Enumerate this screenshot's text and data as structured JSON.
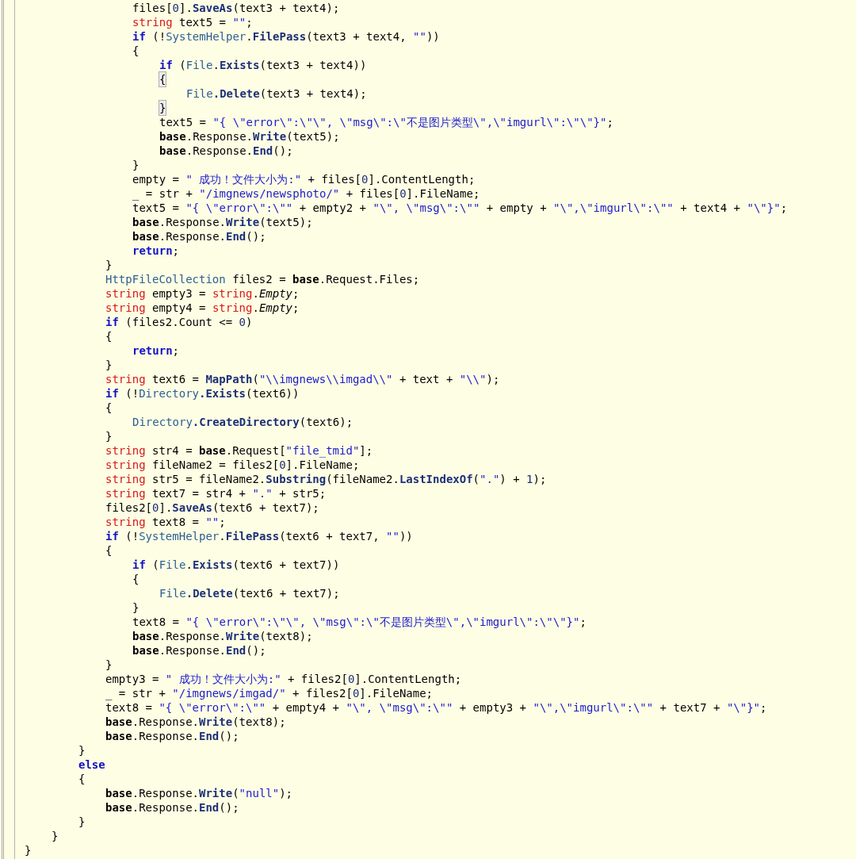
{
  "code_lines": [
    {
      "children": [
        {
          "children": [
            {
              "children": [
                {
                  "children": [
                    {
                      "tokens": [
                        "files[",
                        {
                          "kind": "number",
                          "text": "0"
                        },
                        "].",
                        {
                          "kind": "method",
                          "text": "SaveAs"
                        },
                        "(text3 + text4);"
                      ]
                    },
                    {
                      "tokens": [
                        {
                          "kind": "keyword_type",
                          "text": "string"
                        },
                        " text5 = ",
                        {
                          "kind": "string",
                          "text": "\"\""
                        },
                        ";"
                      ]
                    },
                    {
                      "tokens": [
                        {
                          "kind": "keyword",
                          "text": "if"
                        },
                        " (!",
                        {
                          "kind": "type",
                          "text": "SystemHelper"
                        },
                        ".",
                        {
                          "kind": "method",
                          "text": "FilePass"
                        },
                        "(text3 + text4, ",
                        {
                          "kind": "string",
                          "text": "\"\""
                        },
                        "))"
                      ]
                    },
                    {
                      "tokens": [
                        "{"
                      ],
                      "children": [
                        {
                          "tokens": [
                            {
                              "kind": "keyword",
                              "text": "if"
                            },
                            " (",
                            {
                              "kind": "type",
                              "text": "File"
                            },
                            ".",
                            {
                              "kind": "method",
                              "text": "Exists"
                            },
                            "(text3 + text4))"
                          ]
                        },
                        {
                          "tokens": [
                            {
                              "kind": "brace_match",
                              "text": "{"
                            }
                          ],
                          "children": [
                            {
                              "tokens": [
                                {
                                  "kind": "type",
                                  "text": "File"
                                },
                                {
                                  "kind": "method",
                                  "text": ".Delete"
                                },
                                "(text3 + text4);"
                              ]
                            }
                          ]
                        },
                        {
                          "tokens": [
                            {
                              "kind": "brace_match",
                              "text": "}"
                            }
                          ]
                        },
                        {
                          "tokens": [
                            "text5 = ",
                            {
                              "kind": "string",
                              "text": "\"{ \\\"error\\\":\\\"\\\", \\\"msg\\\":\\\"不是图片类型\\\",\\\"imgurl\\\":\\\"\\\"}\""
                            },
                            ";"
                          ]
                        },
                        {
                          "tokens": [
                            {
                              "kind": "base",
                              "text": "base"
                            },
                            ".Response.",
                            {
                              "kind": "method",
                              "text": "Write"
                            },
                            "(text5);"
                          ]
                        },
                        {
                          "tokens": [
                            {
                              "kind": "base",
                              "text": "base"
                            },
                            ".Response.",
                            {
                              "kind": "method",
                              "text": "End"
                            },
                            "();"
                          ]
                        }
                      ]
                    },
                    {
                      "tokens": [
                        "}"
                      ]
                    },
                    {
                      "tokens": [
                        "empty = ",
                        {
                          "kind": "string",
                          "text": "\" 成功！文件大小为:\""
                        },
                        " + files[",
                        {
                          "kind": "number",
                          "text": "0"
                        },
                        "].ContentLength;"
                      ]
                    },
                    {
                      "tokens": [
                        "_ = str + ",
                        {
                          "kind": "string",
                          "text": "\"/imgnews/newsphoto/\""
                        },
                        " + files[",
                        {
                          "kind": "number",
                          "text": "0"
                        },
                        "].FileName;"
                      ]
                    },
                    {
                      "tokens": [
                        "text5 = ",
                        {
                          "kind": "string",
                          "text": "\"{ \\\"error\\\":\\\"\""
                        },
                        " + empty2 + ",
                        {
                          "kind": "string",
                          "text": "\"\\\", \\\"msg\\\":\\\"\""
                        },
                        " + empty + ",
                        {
                          "kind": "string",
                          "text": "\"\\\",\\\"imgurl\\\":\\\"\""
                        },
                        " + text4 + ",
                        {
                          "kind": "string",
                          "text": "\"\\\"}\""
                        },
                        ";"
                      ]
                    },
                    {
                      "tokens": [
                        {
                          "kind": "base",
                          "text": "base"
                        },
                        ".Response.",
                        {
                          "kind": "method",
                          "text": "Write"
                        },
                        "(text5);"
                      ]
                    },
                    {
                      "tokens": [
                        {
                          "kind": "base",
                          "text": "base"
                        },
                        ".Response.",
                        {
                          "kind": "method",
                          "text": "End"
                        },
                        "();"
                      ]
                    },
                    {
                      "tokens": [
                        {
                          "kind": "keyword",
                          "text": "return"
                        },
                        ";"
                      ]
                    }
                  ]
                },
                {
                  "tokens": [
                    "}"
                  ]
                },
                {
                  "tokens": [
                    {
                      "kind": "type",
                      "text": "HttpFileCollection"
                    },
                    " files2 = ",
                    {
                      "kind": "base",
                      "text": "base"
                    },
                    ".Request.Files;"
                  ]
                },
                {
                  "tokens": [
                    {
                      "kind": "keyword_type",
                      "text": "string"
                    },
                    " empty3 = ",
                    {
                      "kind": "keyword_type",
                      "text": "string"
                    },
                    ".",
                    {
                      "kind": "static",
                      "text": "Empty"
                    },
                    ";"
                  ]
                },
                {
                  "tokens": [
                    {
                      "kind": "keyword_type",
                      "text": "string"
                    },
                    " empty4 = ",
                    {
                      "kind": "keyword_type",
                      "text": "string"
                    },
                    ".",
                    {
                      "kind": "static",
                      "text": "Empty"
                    },
                    ";"
                  ]
                },
                {
                  "tokens": [
                    {
                      "kind": "keyword",
                      "text": "if"
                    },
                    " (files2.Count <= ",
                    {
                      "kind": "number",
                      "text": "0"
                    },
                    ")"
                  ]
                },
                {
                  "tokens": [
                    "{"
                  ],
                  "children": [
                    {
                      "tokens": [
                        {
                          "kind": "keyword",
                          "text": "return"
                        },
                        ";"
                      ]
                    }
                  ]
                },
                {
                  "tokens": [
                    "}"
                  ]
                },
                {
                  "tokens": [
                    {
                      "kind": "keyword_type",
                      "text": "string"
                    },
                    " text6 = ",
                    {
                      "kind": "method",
                      "text": "MapPath"
                    },
                    "(",
                    {
                      "kind": "string",
                      "text": "\"\\\\imgnews\\\\imgad\\\\\""
                    },
                    " + text + ",
                    {
                      "kind": "string",
                      "text": "\"\\\\\""
                    },
                    ");"
                  ]
                },
                {
                  "tokens": [
                    {
                      "kind": "keyword",
                      "text": "if"
                    },
                    " (!",
                    {
                      "kind": "type",
                      "text": "Directory"
                    },
                    {
                      "kind": "method",
                      "text": ".Exists"
                    },
                    "(text6))"
                  ]
                },
                {
                  "tokens": [
                    "{"
                  ],
                  "children": [
                    {
                      "tokens": [
                        {
                          "kind": "type",
                          "text": "Directory"
                        },
                        {
                          "kind": "method",
                          "text": ".CreateDirectory"
                        },
                        "(text6);"
                      ]
                    }
                  ]
                },
                {
                  "tokens": [
                    "}"
                  ]
                },
                {
                  "tokens": [
                    {
                      "kind": "keyword_type",
                      "text": "string"
                    },
                    " str4 = ",
                    {
                      "kind": "base",
                      "text": "base"
                    },
                    ".Request[",
                    {
                      "kind": "string",
                      "text": "\"file_tmid\""
                    },
                    "];"
                  ]
                },
                {
                  "tokens": [
                    {
                      "kind": "keyword_type",
                      "text": "string"
                    },
                    " fileName2 = files2[",
                    {
                      "kind": "number",
                      "text": "0"
                    },
                    "].FileName;"
                  ]
                },
                {
                  "tokens": [
                    {
                      "kind": "keyword_type",
                      "text": "string"
                    },
                    " str5 = fileName2.",
                    {
                      "kind": "method",
                      "text": "Substring"
                    },
                    "(fileName2.",
                    {
                      "kind": "method",
                      "text": "LastIndexOf"
                    },
                    "(",
                    {
                      "kind": "string",
                      "text": "\".\""
                    },
                    ") + ",
                    {
                      "kind": "number",
                      "text": "1"
                    },
                    ");"
                  ]
                },
                {
                  "tokens": [
                    {
                      "kind": "keyword_type",
                      "text": "string"
                    },
                    " text7 = str4 + ",
                    {
                      "kind": "string",
                      "text": "\".\""
                    },
                    " + str5;"
                  ]
                },
                {
                  "tokens": [
                    "files2[",
                    {
                      "kind": "number",
                      "text": "0"
                    },
                    "].",
                    {
                      "kind": "method",
                      "text": "SaveAs"
                    },
                    "(text6 + text7);"
                  ]
                },
                {
                  "tokens": [
                    {
                      "kind": "keyword_type",
                      "text": "string"
                    },
                    " text8 = ",
                    {
                      "kind": "string",
                      "text": "\"\""
                    },
                    ";"
                  ]
                },
                {
                  "tokens": [
                    {
                      "kind": "keyword",
                      "text": "if"
                    },
                    " (!",
                    {
                      "kind": "type",
                      "text": "SystemHelper"
                    },
                    ".",
                    {
                      "kind": "method",
                      "text": "FilePass"
                    },
                    "(text6 + text7, ",
                    {
                      "kind": "string",
                      "text": "\"\""
                    },
                    "))"
                  ]
                },
                {
                  "tokens": [
                    "{"
                  ],
                  "children": [
                    {
                      "tokens": [
                        {
                          "kind": "keyword",
                          "text": "if"
                        },
                        " (",
                        {
                          "kind": "type",
                          "text": "File"
                        },
                        ".",
                        {
                          "kind": "method",
                          "text": "Exists"
                        },
                        "(text6 + text7))"
                      ]
                    },
                    {
                      "tokens": [
                        "{"
                      ],
                      "children": [
                        {
                          "tokens": [
                            {
                              "kind": "type",
                              "text": "File"
                            },
                            {
                              "kind": "method",
                              "text": ".Delete"
                            },
                            "(text6 + text7);"
                          ]
                        }
                      ]
                    },
                    {
                      "tokens": [
                        "}"
                      ]
                    },
                    {
                      "tokens": [
                        "text8 = ",
                        {
                          "kind": "string",
                          "text": "\"{ \\\"error\\\":\\\"\\\", \\\"msg\\\":\\\"不是图片类型\\\",\\\"imgurl\\\":\\\"\\\"}\""
                        },
                        ";"
                      ]
                    },
                    {
                      "tokens": [
                        {
                          "kind": "base",
                          "text": "base"
                        },
                        ".Response.",
                        {
                          "kind": "method",
                          "text": "Write"
                        },
                        "(text8);"
                      ]
                    },
                    {
                      "tokens": [
                        {
                          "kind": "base",
                          "text": "base"
                        },
                        ".Response.",
                        {
                          "kind": "method",
                          "text": "End"
                        },
                        "();"
                      ]
                    }
                  ]
                },
                {
                  "tokens": [
                    "}"
                  ]
                },
                {
                  "tokens": [
                    "empty3 = ",
                    {
                      "kind": "string",
                      "text": "\" 成功！文件大小为:\""
                    },
                    " + files2[",
                    {
                      "kind": "number",
                      "text": "0"
                    },
                    "].ContentLength;"
                  ]
                },
                {
                  "tokens": [
                    "_ = str + ",
                    {
                      "kind": "string",
                      "text": "\"/imgnews/imgad/\""
                    },
                    " + files2[",
                    {
                      "kind": "number",
                      "text": "0"
                    },
                    "].FileName;"
                  ]
                },
                {
                  "tokens": [
                    "text8 = ",
                    {
                      "kind": "string",
                      "text": "\"{ \\\"error\\\":\\\"\""
                    },
                    " + empty4 + ",
                    {
                      "kind": "string",
                      "text": "\"\\\", \\\"msg\\\":\\\"\""
                    },
                    " + empty3 + ",
                    {
                      "kind": "string",
                      "text": "\"\\\",\\\"imgurl\\\":\\\"\""
                    },
                    " + text7 + ",
                    {
                      "kind": "string",
                      "text": "\"\\\"}\""
                    },
                    ";"
                  ]
                },
                {
                  "tokens": [
                    {
                      "kind": "base",
                      "text": "base"
                    },
                    ".Response.",
                    {
                      "kind": "method",
                      "text": "Write"
                    },
                    "(text8);"
                  ]
                },
                {
                  "tokens": [
                    {
                      "kind": "base",
                      "text": "base"
                    },
                    ".Response.",
                    {
                      "kind": "method",
                      "text": "End"
                    },
                    "();"
                  ]
                }
              ]
            },
            {
              "tokens": [
                "}"
              ]
            },
            {
              "tokens": [
                {
                  "kind": "keyword",
                  "text": "else"
                }
              ]
            },
            {
              "tokens": [
                "{"
              ],
              "children": [
                {
                  "tokens": [
                    {
                      "kind": "base",
                      "text": "base"
                    },
                    ".Response.",
                    {
                      "kind": "method",
                      "text": "Write"
                    },
                    "(",
                    {
                      "kind": "string",
                      "text": "\"null\""
                    },
                    ");"
                  ]
                },
                {
                  "tokens": [
                    {
                      "kind": "base",
                      "text": "base"
                    },
                    ".Response.",
                    {
                      "kind": "method",
                      "text": "End"
                    },
                    "();"
                  ]
                }
              ]
            },
            {
              "tokens": [
                "}"
              ]
            }
          ]
        },
        {
          "tokens": [
            "}"
          ]
        }
      ]
    },
    {
      "tokens": [
        "}"
      ]
    }
  ]
}
